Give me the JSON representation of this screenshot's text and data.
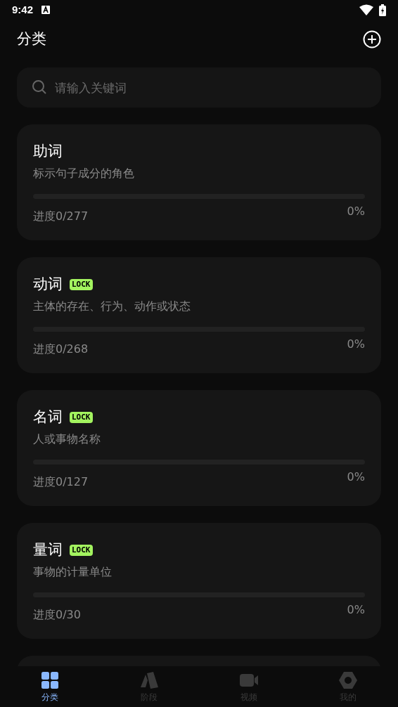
{
  "status_bar": {
    "time": "9:42"
  },
  "header": {
    "title": "分类"
  },
  "search": {
    "placeholder": "请输入关键词"
  },
  "categories": [
    {
      "name": "助词",
      "description": "标示句子成分的角色",
      "progress": "进度0/277",
      "level": 0,
      "percent": "0%"
    },
    {
      "name": "动词",
      "lock_label": "LOCK",
      "description": "主体的存在、行为、动作或状态",
      "progress": "进度0/268",
      "level": 0,
      "percent": "0%"
    },
    {
      "name": "名词",
      "lock_label": "LOCK",
      "description": "人或事物名称",
      "progress": "进度0/127",
      "level": 0,
      "percent": "0%"
    },
    {
      "name": "量词",
      "lock_label": "LOCK",
      "description": "事物的计量单位",
      "progress": "进度0/30",
      "level": 0,
      "percent": "0%"
    }
  ],
  "tabs": [
    {
      "kind": "grid",
      "label": "分类",
      "selected": true
    },
    {
      "kind": "stage",
      "label": "阶段",
      "selected": false
    },
    {
      "kind": "video",
      "label": "视频",
      "selected": false
    },
    {
      "kind": "profile",
      "label": "我的",
      "selected": false
    }
  ]
}
